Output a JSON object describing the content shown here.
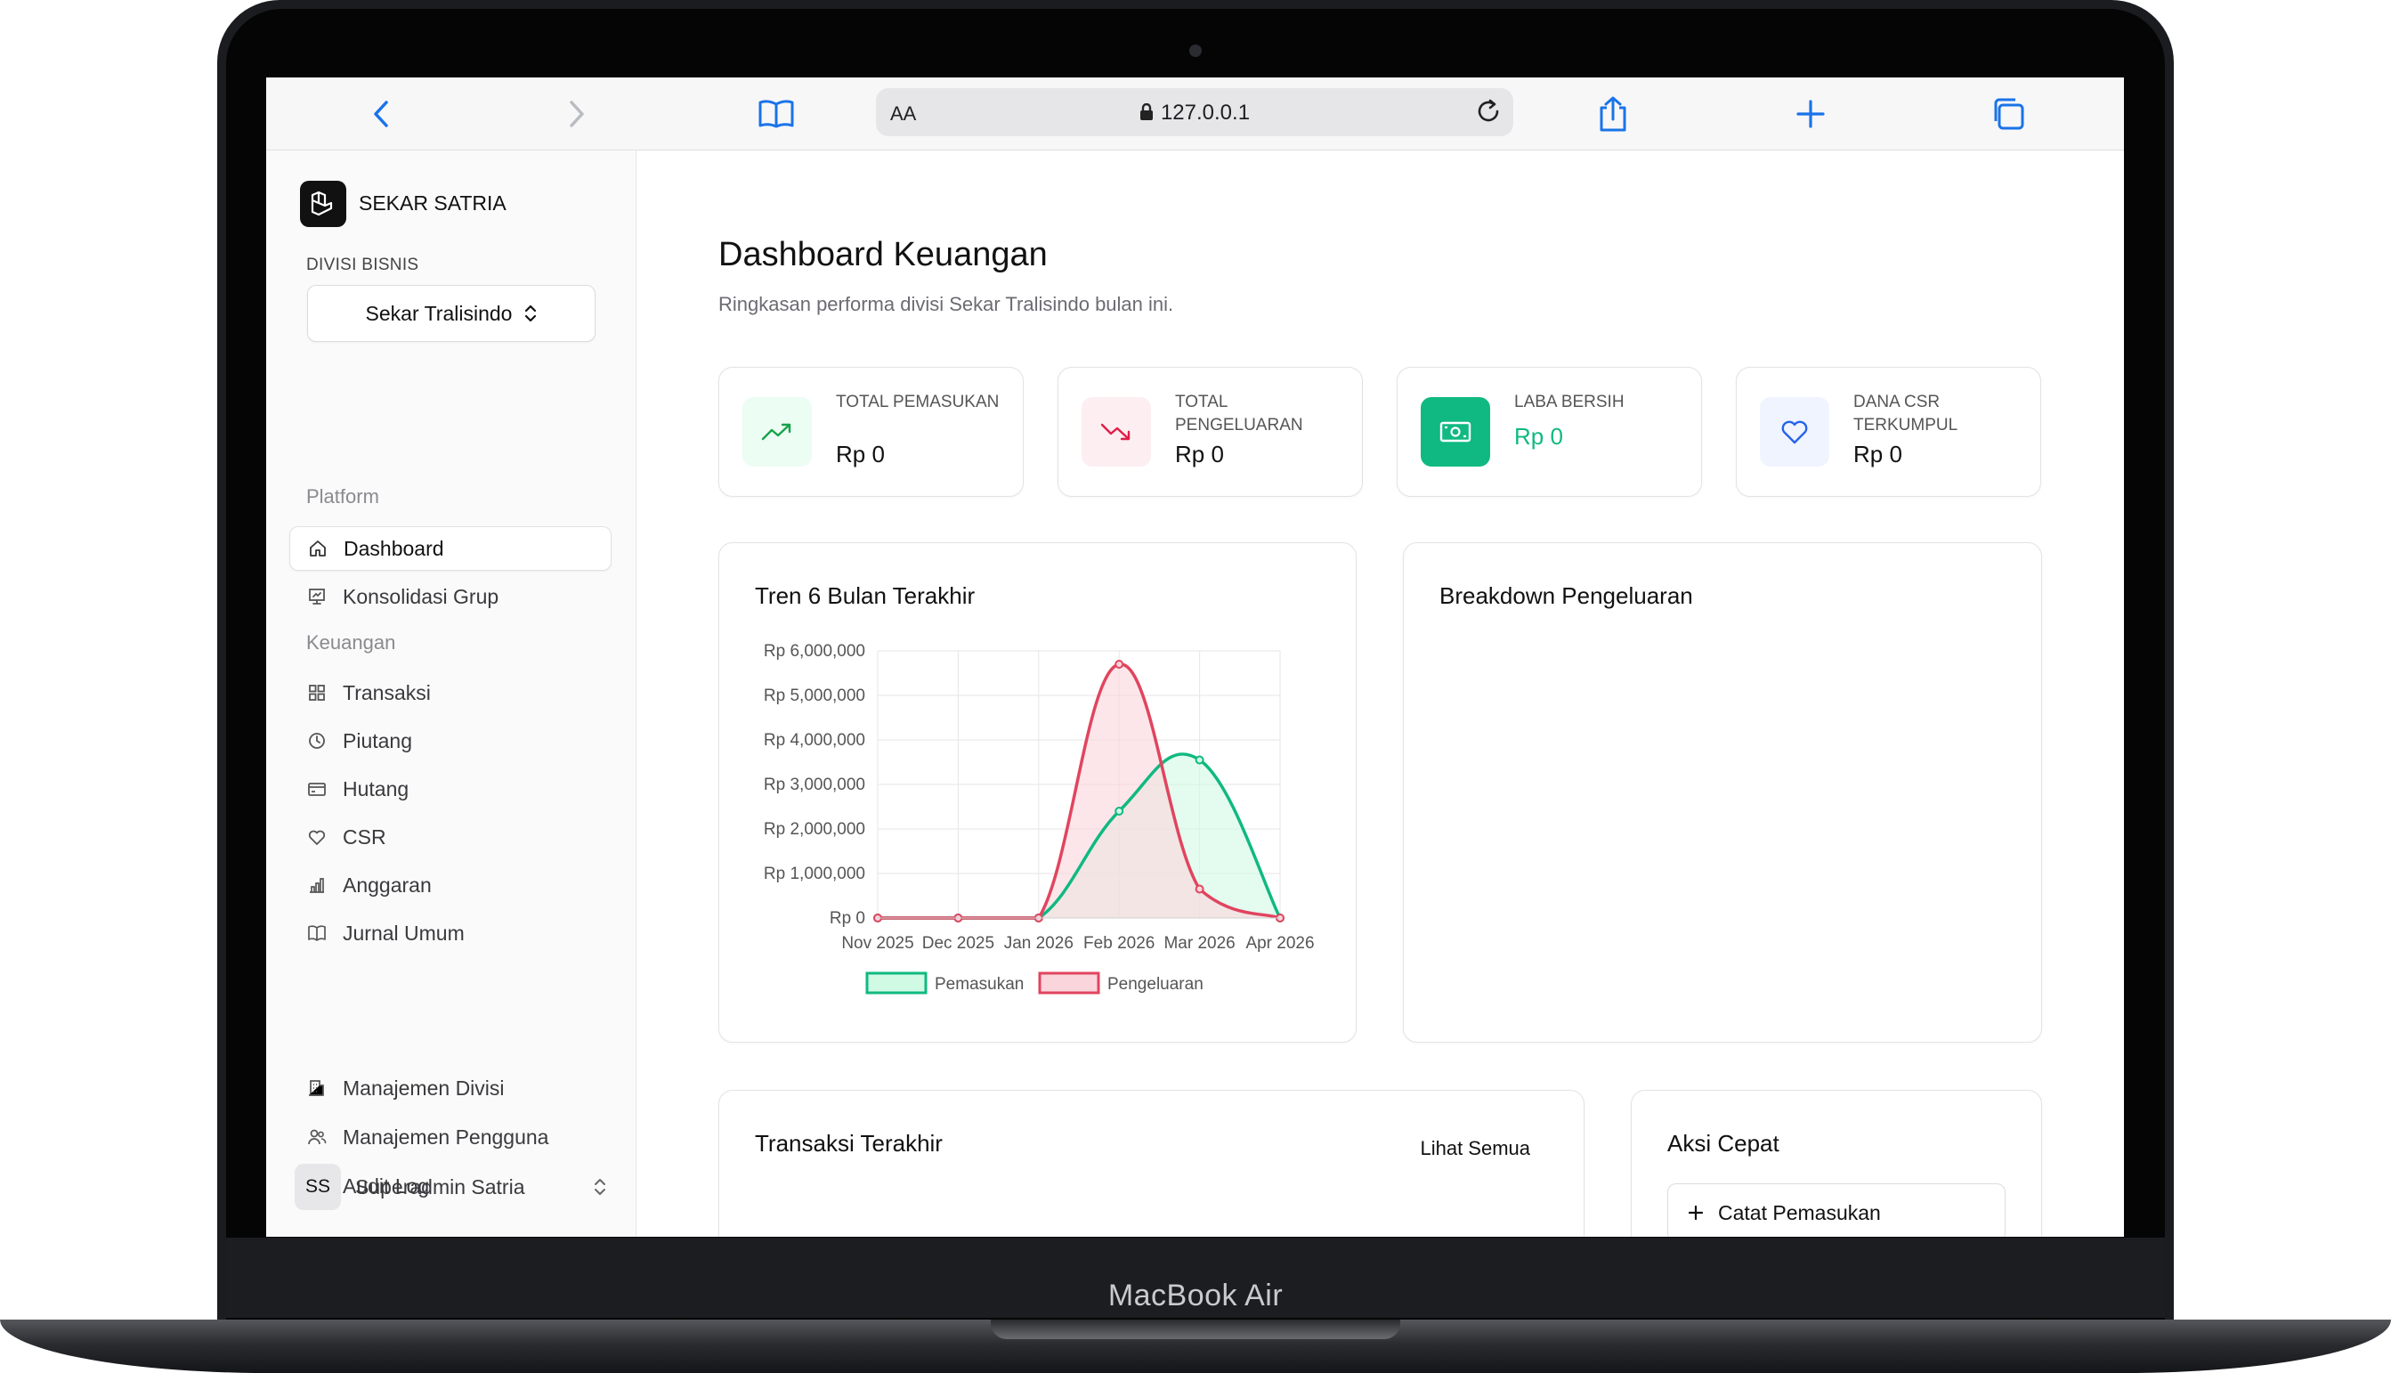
{
  "device": {
    "label": "MacBook Air"
  },
  "browser": {
    "url": "127.0.0.1",
    "reader_label": "AA"
  },
  "sidebar": {
    "app_name": "SEKAR SATRIA",
    "division_label": "DIVISI BISNIS",
    "division_value": "Sekar Tralisindo",
    "sections": {
      "platform": "Platform",
      "keuangan": "Keuangan"
    },
    "items": [
      {
        "label": "Dashboard",
        "icon": "home-icon"
      },
      {
        "label": "Konsolidasi Grup",
        "icon": "presentation-icon"
      },
      {
        "label": "Transaksi",
        "icon": "grid-icon"
      },
      {
        "label": "Piutang",
        "icon": "clock-icon"
      },
      {
        "label": "Hutang",
        "icon": "card-icon"
      },
      {
        "label": "CSR",
        "icon": "heart-icon"
      },
      {
        "label": "Anggaran",
        "icon": "bar-chart-icon"
      },
      {
        "label": "Jurnal Umum",
        "icon": "book-icon"
      },
      {
        "label": "Manajemen Divisi",
        "icon": "building-icon"
      },
      {
        "label": "Manajemen Pengguna",
        "icon": "users-icon"
      },
      {
        "label": "Audit Log",
        "icon": "log-icon"
      }
    ],
    "user": {
      "initials": "SS",
      "name": "Superadmin Satria"
    }
  },
  "main": {
    "title": "Dashboard Keuangan",
    "subtitle": "Ringkasan performa divisi Sekar Tralisindo bulan ini.",
    "stats": [
      {
        "label": "TOTAL PEMASUKAN",
        "value": "Rp 0",
        "color": "#16a34a"
      },
      {
        "label": "TOTAL PENGELUARAN",
        "value": "Rp 0",
        "color": "#e11d48"
      },
      {
        "label": "LABA BERSIH",
        "value": "Rp 0",
        "color": "#10b981"
      },
      {
        "label": "DANA CSR TERKUMPUL",
        "value": "Rp 0",
        "color": "#2563eb"
      }
    ],
    "trend_title": "Tren 6 Bulan Terakhir",
    "breakdown_title": "Breakdown Pengeluaran",
    "recent_title": "Transaksi Terakhir",
    "recent_link": "Lihat Semua",
    "quick_title": "Aksi Cepat",
    "quick_actions": [
      "Catat Pemasukan"
    ]
  },
  "chart_data": {
    "type": "line",
    "title": "Tren 6 Bulan Terakhir",
    "categories": [
      "Nov 2025",
      "Dec 2025",
      "Jan 2026",
      "Feb 2026",
      "Mar 2026",
      "Apr 2026"
    ],
    "ylim": [
      0,
      6000000
    ],
    "yticks": [
      "Rp 0",
      "Rp 1,000,000",
      "Rp 2,000,000",
      "Rp 3,000,000",
      "Rp 4,000,000",
      "Rp 5,000,000",
      "Rp 6,000,000"
    ],
    "grid": true,
    "legend": "bottom",
    "series": [
      {
        "name": "Pemasukan",
        "values": [
          0,
          0,
          0,
          2400000,
          3550000,
          0
        ],
        "color": "#10b981",
        "fill": "#d1fae5"
      },
      {
        "name": "Pengeluaran",
        "values": [
          0,
          0,
          0,
          5700000,
          650000,
          0
        ],
        "color": "#e0455f",
        "fill": "#fbd5dc"
      }
    ]
  }
}
